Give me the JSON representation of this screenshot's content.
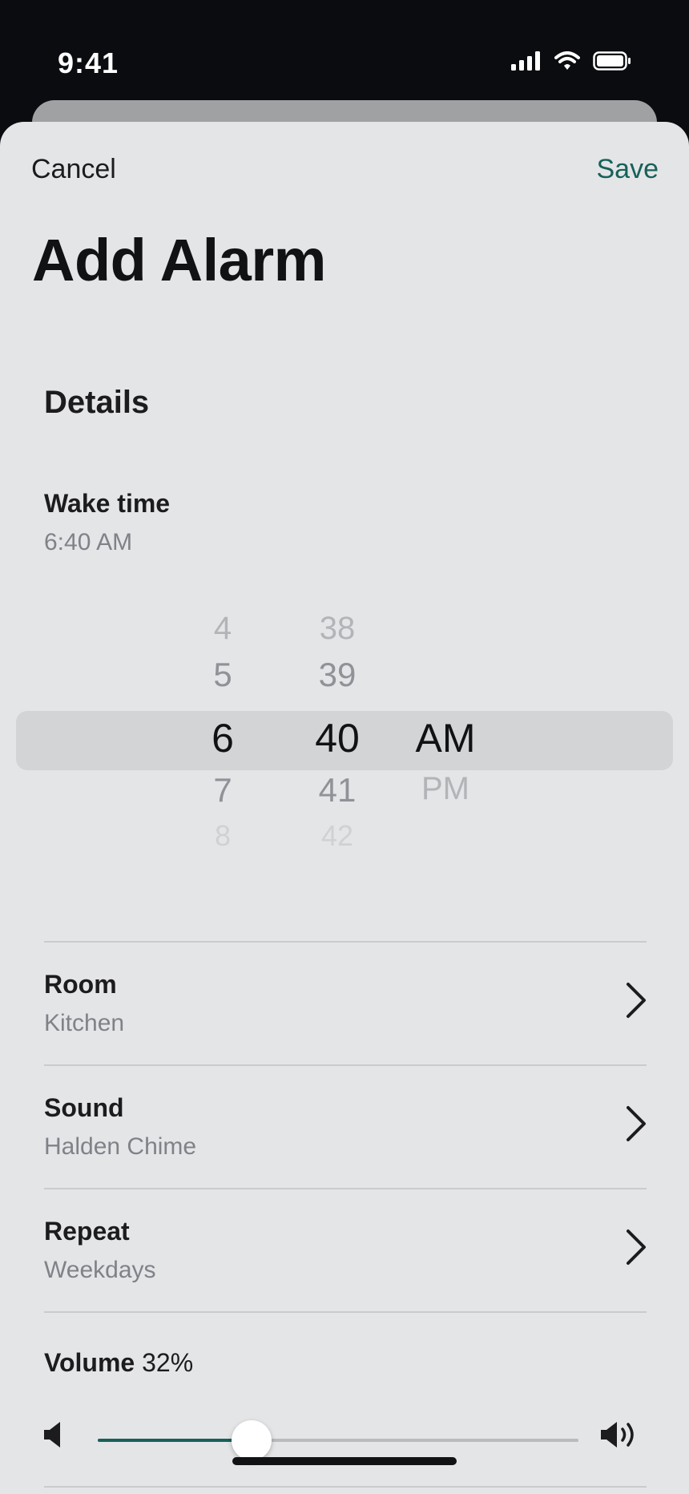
{
  "status_bar": {
    "time": "9:41"
  },
  "nav": {
    "cancel_label": "Cancel",
    "save_label": "Save"
  },
  "title": "Add Alarm",
  "details": {
    "section_title": "Details",
    "wake_time_label": "Wake time",
    "wake_time_value": "6:40 AM"
  },
  "picker": {
    "hours": [
      "4",
      "5",
      "6",
      "7",
      "8"
    ],
    "minutes": [
      "38",
      "39",
      "40",
      "41",
      "42"
    ],
    "ampm": [
      "AM",
      "PM"
    ],
    "selected": {
      "hour": "6",
      "minute": "40",
      "ampm": "AM"
    }
  },
  "rows": [
    {
      "label": "Room",
      "value": "Kitchen"
    },
    {
      "label": "Sound",
      "value": "Halden Chime"
    },
    {
      "label": "Repeat",
      "value": "Weekdays"
    }
  ],
  "volume": {
    "label": "Volume",
    "percent_text": "32%",
    "level": 0.32
  },
  "colors": {
    "accent": "#17615a",
    "background": "#e4e5e7",
    "text": "#1c1c1e",
    "secondary_text": "#7f8287"
  },
  "icons": {
    "signal": "cellular-signal-icon",
    "wifi": "wifi-icon",
    "battery": "battery-icon",
    "chevron": "chevron-right-icon",
    "volume_low": "speaker-low-icon",
    "volume_high": "speaker-high-icon"
  }
}
